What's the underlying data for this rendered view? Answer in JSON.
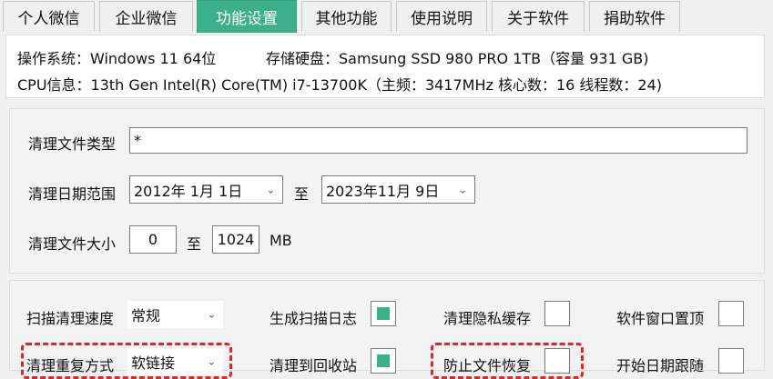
{
  "tabs": [
    {
      "label": "个人微信",
      "active": false
    },
    {
      "label": "企业微信",
      "active": false
    },
    {
      "label": "功能设置",
      "active": true
    },
    {
      "label": "其他功能",
      "active": false
    },
    {
      "label": "使用说明",
      "active": false
    },
    {
      "label": "关于软件",
      "active": false
    },
    {
      "label": "捐助软件",
      "active": false
    }
  ],
  "system_info": {
    "os": "操作系统：Windows 11 64位",
    "disk": "存储硬盘：Samsung SSD 980 PRO 1TB（容量 931 GB)",
    "cpu": "CPU信息：13th Gen Intel(R) Core(TM) i7-13700K（主频：3417MHz  核心数：16  线程数：24)"
  },
  "filters": {
    "file_type_label": "清理文件类型",
    "file_type_value": "*",
    "date_range_label": "清理日期范围",
    "date_from": "2012年  1月  1日",
    "date_to": "2023年11月  9日",
    "range_sep": "至",
    "size_label": "清理文件大小",
    "size_min": "0",
    "size_max": "1024",
    "size_unit": "MB"
  },
  "options": {
    "speed_label": "扫描清理速度",
    "speed_value": "常规",
    "scan_log_label": "生成扫描日志",
    "scan_log_checked": true,
    "privacy_cache_label": "清理隐私缓存",
    "privacy_cache_checked": false,
    "window_top_label": "软件窗口置顶",
    "window_top_checked": false,
    "duplicate_mode_label": "清理重复方式",
    "duplicate_mode_value": "软链接",
    "recycle_label": "清理到回收站",
    "recycle_checked": true,
    "prevent_recovery_label": "防止文件恢复",
    "prevent_recovery_checked": false,
    "date_follow_label": "开始日期跟随",
    "date_follow_checked": false
  },
  "colors": {
    "accent": "#3cb08a",
    "highlight": "#e02525"
  }
}
